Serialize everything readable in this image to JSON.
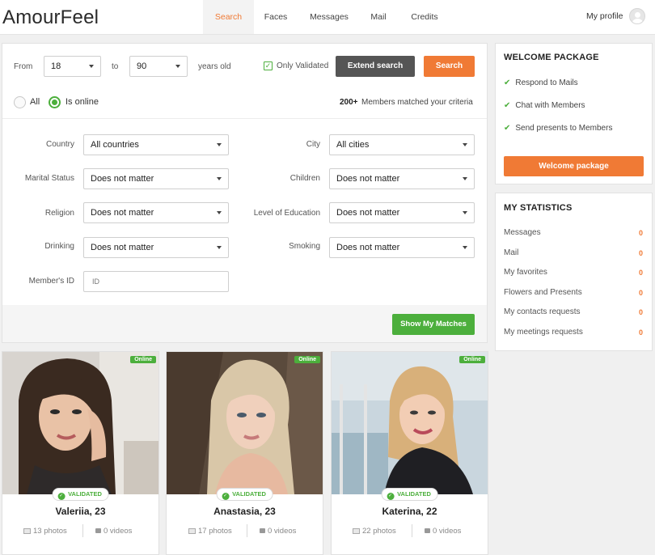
{
  "brand": {
    "logo": "AmourFeel"
  },
  "nav": {
    "items": [
      {
        "label": "Search",
        "active": true
      },
      {
        "label": "Faces",
        "active": false
      },
      {
        "label": "Messages",
        "active": false
      },
      {
        "label": "Mail",
        "active": false
      },
      {
        "label": "Credits",
        "active": false
      }
    ],
    "my_profile": "My profile"
  },
  "search": {
    "from_label": "From",
    "from_value": "18",
    "to_label": "to",
    "to_value": "90",
    "years_label": "years old",
    "only_validated_label": "Only Validated",
    "only_validated_checked": true,
    "extend_label": "Extend search",
    "search_label": "Search",
    "radio_all": "All",
    "radio_online": "Is online",
    "radio_selected": "Is online",
    "matched_count": "200+",
    "matched_text": "Members matched your criteria"
  },
  "filters": {
    "country": {
      "label": "Country",
      "value": "All countries"
    },
    "city": {
      "label": "City",
      "value": "All cities"
    },
    "marital": {
      "label": "Marital Status",
      "value": "Does not matter"
    },
    "children": {
      "label": "Children",
      "value": "Does not matter"
    },
    "religion": {
      "label": "Religion",
      "value": "Does not matter"
    },
    "education": {
      "label": "Level of Education",
      "value": "Does not matter"
    },
    "drinking": {
      "label": "Drinking",
      "value": "Does not matter"
    },
    "smoking": {
      "label": "Smoking",
      "value": "Does not matter"
    },
    "member_id": {
      "label": "Member's ID",
      "placeholder": "ID"
    },
    "show_matches": "Show My Matches"
  },
  "welcome": {
    "title": "WELCOME PACKAGE",
    "items": [
      "Respond to Mails",
      "Chat with Members",
      "Send presents to Members"
    ],
    "button": "Welcome package"
  },
  "stats": {
    "title": "MY STATISTICS",
    "items": [
      {
        "label": "Messages",
        "value": "0"
      },
      {
        "label": "Mail",
        "value": "0"
      },
      {
        "label": "My favorites",
        "value": "0"
      },
      {
        "label": "Flowers and Presents",
        "value": "0"
      },
      {
        "label": "My contacts requests",
        "value": "0"
      },
      {
        "label": "My meetings requests",
        "value": "0"
      }
    ]
  },
  "profiles": [
    {
      "name": "Valeriia, 23",
      "photos": "13 photos",
      "videos": "0 videos",
      "online": "Online",
      "validated": "VALIDATED"
    },
    {
      "name": "Anastasia, 23",
      "photos": "17 photos",
      "videos": "0 videos",
      "online": "Online",
      "validated": "VALIDATED"
    },
    {
      "name": "Katerina, 22",
      "photos": "22 photos",
      "videos": "0 videos",
      "online": "Online",
      "validated": "VALIDATED"
    }
  ],
  "colors": {
    "accent": "#f07a35",
    "green": "#4caf3c",
    "dark_button": "#555555"
  }
}
